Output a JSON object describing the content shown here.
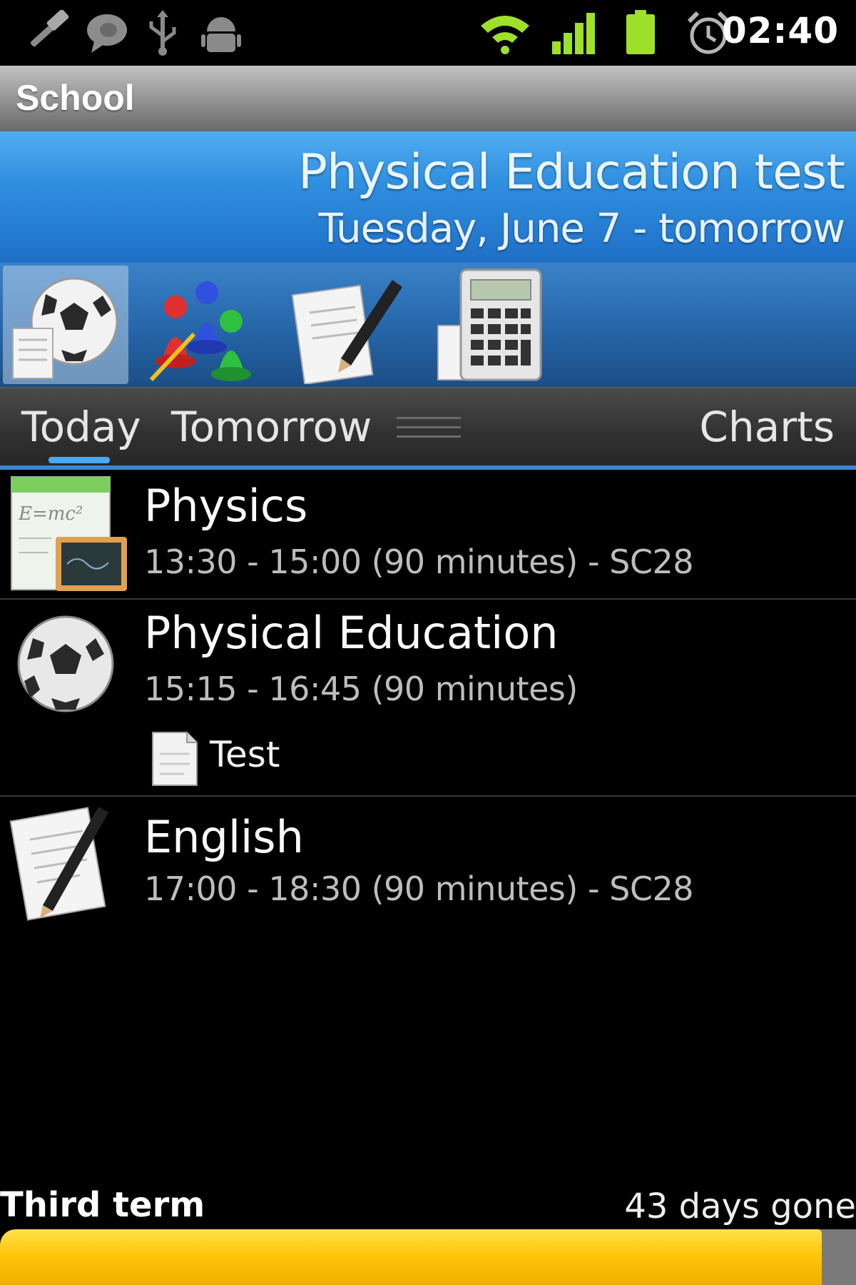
{
  "status_bar": {
    "time": "02:40",
    "left_icons": [
      "hammer-icon",
      "chat-bubble-icon",
      "usb-icon",
      "android-debug-icon"
    ],
    "right_icons": [
      "wifi-icon",
      "signal-icon",
      "battery-icon",
      "alarm-icon"
    ],
    "accent": "#9ee02a"
  },
  "app": {
    "title": "School"
  },
  "event": {
    "title": "Physical Education test",
    "date": "Tuesday, June 7 - tomorrow",
    "header_color": "#2f8fe0"
  },
  "subject_icons": [
    {
      "name": "physical-education-icon",
      "selected": true
    },
    {
      "name": "chess-pieces-icon",
      "selected": false
    },
    {
      "name": "english-writing-icon",
      "selected": false
    },
    {
      "name": "calculator-icon",
      "selected": false
    }
  ],
  "tabs": {
    "today": "Today",
    "tomorrow": "Tomorrow",
    "charts": "Charts",
    "active": "Today",
    "indicator_color": "#4aa8f0"
  },
  "lessons": [
    {
      "subject": "Physics",
      "details": "13:30 - 15:00 (90 minutes) - SC28",
      "icon": "physics-icon"
    },
    {
      "subject": "Physical Education",
      "details": "15:15 - 16:45 (90 minutes)",
      "icon": "soccer-ball-icon",
      "note": "Test",
      "note_icon": "document-icon"
    },
    {
      "subject": "English",
      "details": "17:00 - 18:30 (90 minutes) - SC28",
      "icon": "writing-pencil-icon"
    }
  ],
  "term": {
    "label": "Third term",
    "status": "43 days gone",
    "progress": 0.96,
    "progress_color": "#ffc70a"
  }
}
